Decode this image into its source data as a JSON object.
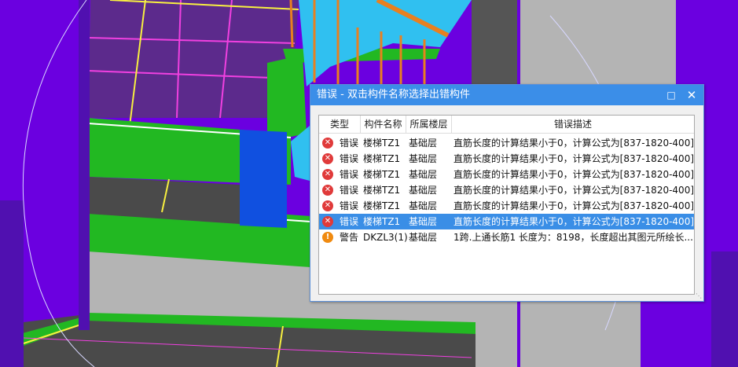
{
  "dialog": {
    "title": "错误 - 双击构件名称选择出错构件",
    "maximize_icon": "maximize-icon",
    "close_icon": "close-icon"
  },
  "table": {
    "headers": [
      "类型",
      "构件名称",
      "所属楼层",
      "错误描述"
    ],
    "rows": [
      {
        "icon": "error-icon",
        "type": "错误",
        "name": "楼梯TZ1",
        "floor": "基础层",
        "desc": "直筋长度的计算结果小于0，计算公式为[837-1820-400]"
      },
      {
        "icon": "error-icon",
        "type": "错误",
        "name": "楼梯TZ1",
        "floor": "基础层",
        "desc": "直筋长度的计算结果小于0，计算公式为[837-1820-400]"
      },
      {
        "icon": "error-icon",
        "type": "错误",
        "name": "楼梯TZ1",
        "floor": "基础层",
        "desc": "直筋长度的计算结果小于0，计算公式为[837-1820-400]"
      },
      {
        "icon": "error-icon",
        "type": "错误",
        "name": "楼梯TZ1",
        "floor": "基础层",
        "desc": "直筋长度的计算结果小于0，计算公式为[837-1820-400]"
      },
      {
        "icon": "error-icon",
        "type": "错误",
        "name": "楼梯TZ1",
        "floor": "基础层",
        "desc": "直筋长度的计算结果小于0，计算公式为[837-1820-400]"
      },
      {
        "icon": "error-icon",
        "type": "错误",
        "name": "楼梯TZ1",
        "floor": "基础层",
        "desc": "直筋长度的计算结果小于0，计算公式为[837-1820-400]",
        "selected": true
      },
      {
        "icon": "warning-icon",
        "type": "警告",
        "name": "DKZL3(1)",
        "floor": "基础层",
        "desc": "1跨.上通长筋1 长度为：8198，长度超出其图元所绘长..."
      }
    ]
  },
  "colors": {
    "background": "#6b00e0",
    "green": "#22b822",
    "gray": "#b4b4b4",
    "dark_gray": "#505050",
    "cyan": "#30c0f0",
    "blue": "#1050e0",
    "yellow": "#f8f040",
    "magenta": "#f040e0",
    "selected_row": "#3a8ee6",
    "titlebar": "#3b8ee8"
  }
}
